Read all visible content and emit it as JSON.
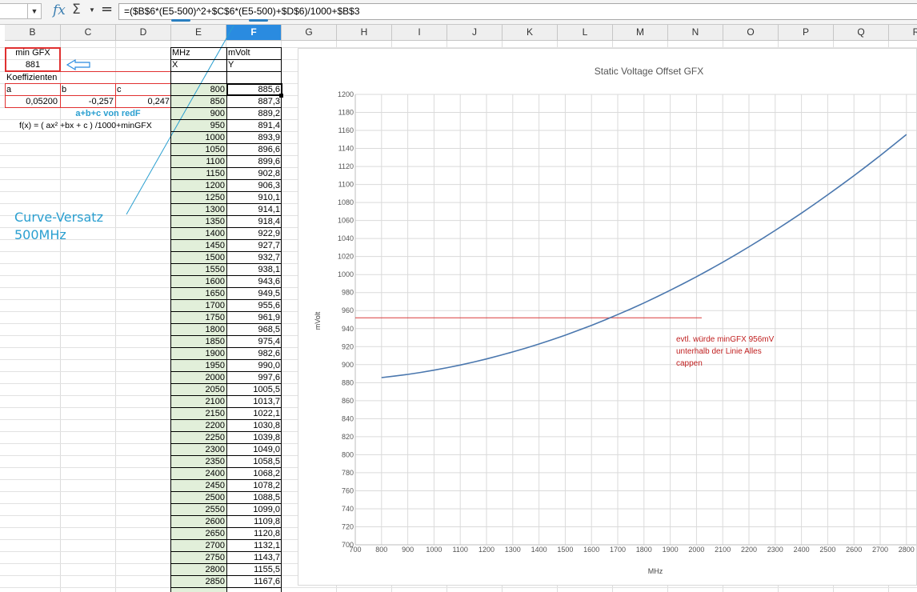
{
  "formula_bar": {
    "name_box": "",
    "formula": "=($B$6*(E5-500)^2+$C$6*(E5-500)+$D$6)/1000+$B$3"
  },
  "columns": [
    "B",
    "C",
    "D",
    "E",
    "F",
    "G",
    "H",
    "I",
    "J",
    "K",
    "L",
    "M",
    "N",
    "O",
    "P",
    "Q",
    "R"
  ],
  "active_column": "F",
  "sheet": {
    "min_gfx_label": "min GFX",
    "min_gfx_value": "881",
    "koeff_label": "Koeffizienten",
    "a_label": "a",
    "b_label": "b",
    "c_label": "c",
    "a_value": "0,05200",
    "b_value": "-0,257",
    "c_value": "0,247",
    "abc_note": "a+b+c von redF",
    "formula_note": "f(x) = ( ax² +bx + c ) /1000+minGFX",
    "mhz_header": "MHz",
    "mvolt_header": "mVolt",
    "x_label": "X",
    "y_label": "Y",
    "callout": [
      "Curve-Versatz",
      "500MHz"
    ]
  },
  "table": {
    "mhz": [
      "800",
      "850",
      "900",
      "950",
      "1000",
      "1050",
      "1100",
      "1150",
      "1200",
      "1250",
      "1300",
      "1350",
      "1400",
      "1450",
      "1500",
      "1550",
      "1600",
      "1650",
      "1700",
      "1750",
      "1800",
      "1850",
      "1900",
      "1950",
      "2000",
      "2050",
      "2100",
      "2150",
      "2200",
      "2250",
      "2300",
      "2350",
      "2400",
      "2450",
      "2500",
      "2550",
      "2600",
      "2650",
      "2700",
      "2750",
      "2800",
      "2850"
    ],
    "mvolt": [
      "885,6",
      "887,3",
      "889,2",
      "891,4",
      "893,9",
      "896,6",
      "899,6",
      "902,8",
      "906,3",
      "910,1",
      "914,1",
      "918,4",
      "922,9",
      "927,7",
      "932,7",
      "938,1",
      "943,6",
      "949,5",
      "955,6",
      "961,9",
      "968,5",
      "975,4",
      "982,6",
      "990,0",
      "997,6",
      "1005,5",
      "1013,7",
      "1022,1",
      "1030,8",
      "1039,8",
      "1049,0",
      "1058,5",
      "1068,2",
      "1078,2",
      "1088,5",
      "1099,0",
      "1109,8",
      "1120,8",
      "1132,1",
      "1143,7",
      "1155,5",
      "1167,6"
    ]
  },
  "colors": {
    "accent": "#2a8be0",
    "red": "#e03030",
    "green_fill": "#e2efda",
    "curve": "#4a77ae",
    "note": "#c02020",
    "callout": "#2a9fd0"
  },
  "chart_data": {
    "type": "line",
    "title": "Static Voltage Offset GFX",
    "xlabel": "MHz",
    "ylabel": "mVolt",
    "xlim": [
      700,
      2850
    ],
    "ylim": [
      700,
      1200
    ],
    "x_ticks": [
      "700",
      "800",
      "900",
      "1000",
      "1100",
      "1200",
      "1300",
      "1400",
      "1500",
      "1600",
      "1700",
      "1800",
      "1900",
      "2000",
      "2100",
      "2200",
      "2300",
      "2400",
      "2500",
      "2600",
      "2700",
      "2800"
    ],
    "y_ticks": [
      "700",
      "720",
      "740",
      "760",
      "780",
      "800",
      "820",
      "840",
      "860",
      "880",
      "900",
      "920",
      "940",
      "960",
      "980",
      "1000",
      "1020",
      "1040",
      "1060",
      "1080",
      "1100",
      "1120",
      "1140",
      "1160",
      "1180",
      "1200"
    ],
    "grid": true,
    "series": [
      {
        "x": [
          800,
          850,
          900,
          950,
          1000,
          1050,
          1100,
          1150,
          1200,
          1250,
          1300,
          1350,
          1400,
          1450,
          1500,
          1550,
          1600,
          1650,
          1700,
          1750,
          1800,
          1850,
          1900,
          1950,
          2000,
          2050,
          2100,
          2150,
          2200,
          2250,
          2300,
          2350,
          2400,
          2450,
          2500,
          2550,
          2600,
          2650,
          2700,
          2750,
          2800,
          2850
        ],
        "y": [
          885.6,
          887.3,
          889.2,
          891.4,
          893.9,
          896.6,
          899.6,
          902.8,
          906.3,
          910.1,
          914.1,
          918.4,
          922.9,
          927.7,
          932.7,
          938.1,
          943.6,
          949.5,
          955.6,
          961.9,
          968.5,
          975.4,
          982.6,
          990.0,
          997.6,
          1005.5,
          1013.7,
          1022.1,
          1030.8,
          1039.8,
          1049.0,
          1058.5,
          1068.2,
          1078.2,
          1088.5,
          1099.0,
          1109.8,
          1120.8,
          1132.1,
          1143.7,
          1155.5,
          1167.6
        ]
      }
    ],
    "reference_line": {
      "y": 952,
      "x_start": 700,
      "x_end": 2020
    },
    "annotation": [
      "evtl. würde minGFX 956mV",
      "unterhalb der Linie Alles",
      "cappen"
    ]
  }
}
